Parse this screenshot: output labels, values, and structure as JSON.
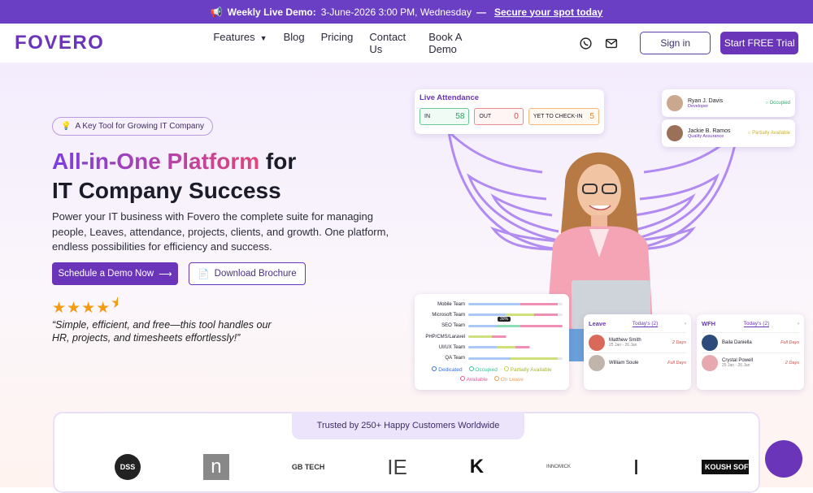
{
  "banner": {
    "text": "Weekly Live Demo:",
    "date": "3-June-2026 3:00 PM, Wednesday",
    "dash": "—",
    "link": "Secure your spot today"
  },
  "nav": {
    "logo": "FOVERO",
    "items": [
      "Features",
      "Blog",
      "Pricing",
      "Contact Us",
      "Book A Demo"
    ],
    "signin": "Sign in",
    "trial": "Start FREE Trial"
  },
  "hero": {
    "pill": "A Key Tool for Growing IT Company",
    "title_grad": "All-in-One Platform",
    "title_rest": " for",
    "title_line2": "IT Company Success",
    "desc": "Power your IT business with Fovero the complete suite for managing people, Leaves, attendance, projects, clients, and growth. One platform, endless possibilities for efficiency and success.",
    "cta_demo": "Schedule a Demo Now",
    "cta_brochure": "Download Brochure",
    "rating": 4.5,
    "quote": "“Simple, efficient, and free—this tool handles our HR, projects, and timesheets effortlessly!”"
  },
  "attendance": {
    "title": "Live Attendance",
    "in_label": "IN",
    "in_value": "58",
    "out_label": "OUT",
    "out_value": "0",
    "yet_label": "YET TO CHECK-IN",
    "yet_value": "5"
  },
  "employees": [
    {
      "name": "Ryan J. Davis",
      "role": "Developer",
      "status": "Occupied",
      "color": "#2aa86a"
    },
    {
      "name": "Jackie B. Ramos",
      "role": "Quality Assurance",
      "status": "Partially Available",
      "color": "#c8b42a"
    }
  ],
  "teams": {
    "rows": [
      "Mobile Team",
      "Microsoft Team",
      "SEO Team",
      "PHP/CMS/Laravel",
      "UI/UX Team",
      "QA Team"
    ],
    "tooltip": "30%",
    "legend": [
      {
        "label": "Dedicated",
        "color": "#3b6fe0"
      },
      {
        "label": "Occupied",
        "color": "#34c38f"
      },
      {
        "label": "Partially Available",
        "color": "#c7d34a"
      },
      {
        "label": "Available",
        "color": "#e85a9a"
      },
      {
        "label": "On Leave",
        "color": "#f39c5a"
      }
    ]
  },
  "leave": {
    "title": "Leave",
    "tab": "Today's (2)",
    "items": [
      {
        "name": "Matthew Smith",
        "date": "25 Jan - 26 Jan",
        "days": "2 Days"
      },
      {
        "name": "William Soule",
        "date": "",
        "days": "Full Days"
      }
    ]
  },
  "wfh": {
    "title": "WFH",
    "tab": "Today's (2)",
    "items": [
      {
        "name": "Baila Daniella",
        "date": "",
        "days": "Full Days"
      },
      {
        "name": "Crystal Powell",
        "date": "25 Jan - 26 Jan",
        "days": "2 Days"
      }
    ]
  },
  "trusted": {
    "badge": "Trusted by 250+ Happy Customers Worldwide",
    "logos": [
      "DSS",
      "n",
      "GB TECH",
      "IE",
      "K",
      "INNOMICK",
      "I",
      "KOUSH SOFTWA"
    ]
  },
  "colors": {
    "primary": "#6a35b8",
    "banner": "#6a3fc4"
  }
}
